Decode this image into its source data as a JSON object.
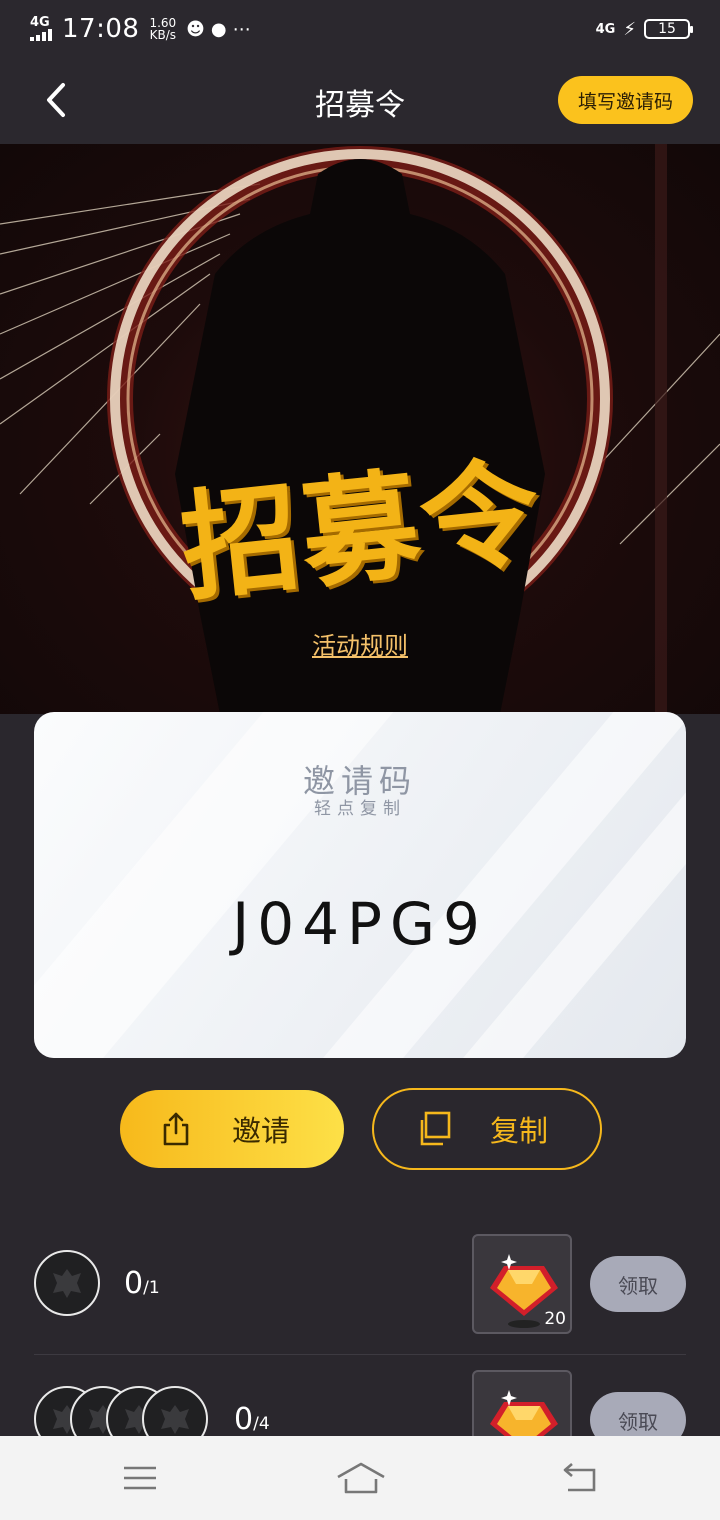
{
  "status_bar": {
    "network": "4G",
    "time": "17:08",
    "speed_value": "1.60",
    "speed_unit": "KB/s",
    "notification_icons": [
      "qq-icon",
      "chat-bubble-icon",
      "more-dots-icon"
    ],
    "right_network": "4G",
    "battery": "15"
  },
  "header": {
    "title": "招募令",
    "invite_code_button": "填写邀请码",
    "accent_color": "#fbc21d"
  },
  "banner": {
    "title": "招募令",
    "rules_link": "活动规则"
  },
  "invite_card": {
    "title": "邀请码",
    "subtitle": "轻点复制",
    "code": "J04PG9"
  },
  "actions": {
    "invite_label": "邀请",
    "copy_label": "复制"
  },
  "rewards": [
    {
      "progress_current": "0",
      "progress_total": "/1",
      "reward_count": "20",
      "claim_label": "领取",
      "avatar_count": 1
    },
    {
      "progress_current": "0",
      "progress_total": "/4",
      "reward_count": "",
      "claim_label": "领取",
      "avatar_count": 4
    }
  ],
  "nav_bar": {
    "icons": [
      "menu-icon",
      "home-icon",
      "back-icon"
    ]
  }
}
